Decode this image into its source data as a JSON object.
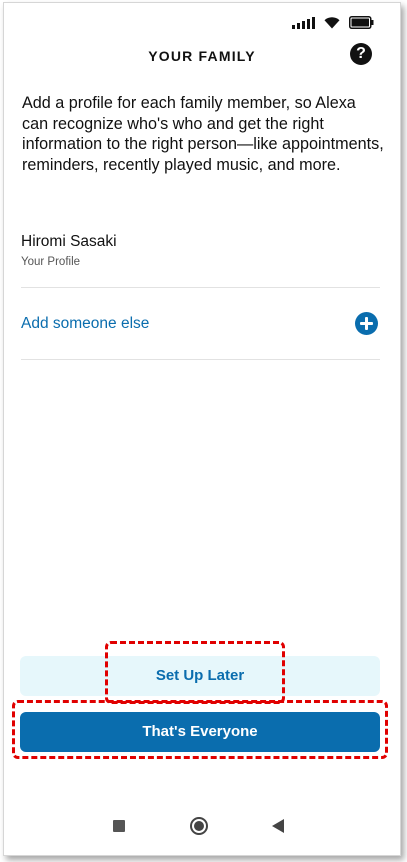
{
  "status_bar": {
    "signal_icon": "cell-signal-icon",
    "wifi_icon": "wifi-icon",
    "battery_icon": "battery-icon"
  },
  "header": {
    "title": "YOUR FAMILY",
    "help_label": "?"
  },
  "intro": {
    "text": "Add a profile for each family member, so Alexa can recognize who's who and get the right information to the right person—like appointments, reminders, recently played music, and more."
  },
  "profile": {
    "name": "Hiromi Sasaki",
    "subtitle": "Your Profile"
  },
  "add_member": {
    "label": "Add someone else",
    "icon": "plus-circle-icon"
  },
  "actions": {
    "set_up_later": "Set Up Later",
    "thats_everyone": "That's Everyone"
  },
  "nav": {
    "recents_icon": "square-icon",
    "home_icon": "circle-icon",
    "back_icon": "triangle-back-icon"
  },
  "colors": {
    "accent": "#0a6dae",
    "secondary_button_bg": "#e6f7fb",
    "highlight": "#e00000"
  }
}
